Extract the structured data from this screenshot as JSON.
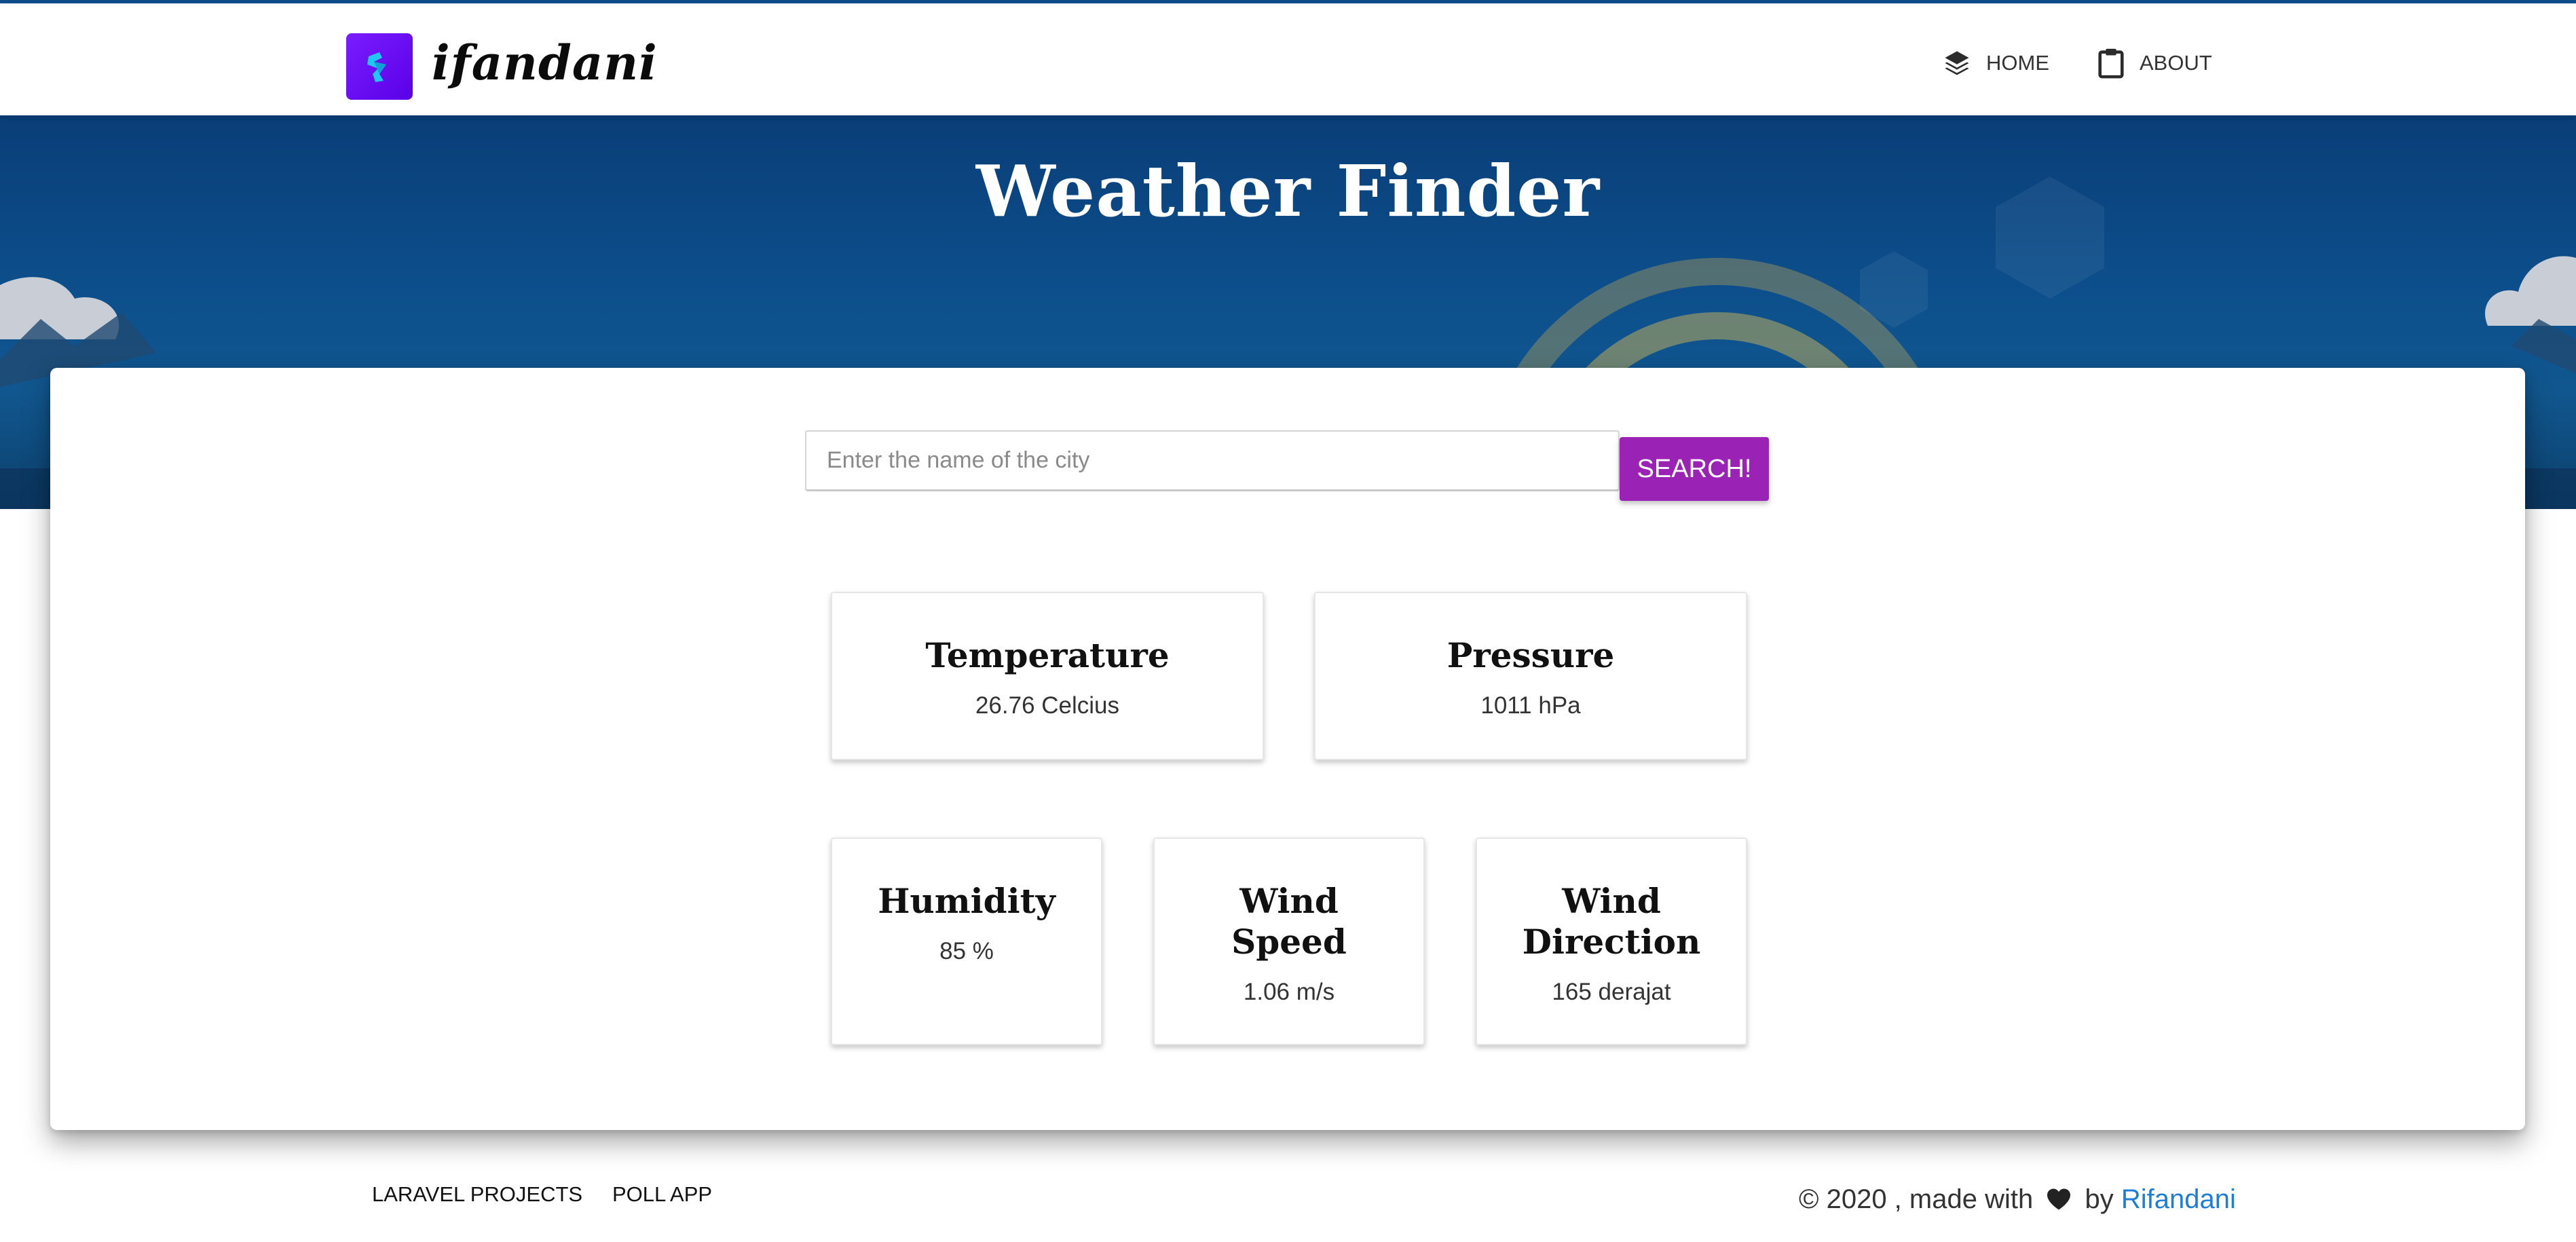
{
  "brand": {
    "name": "ifandani",
    "logo_glyph": "r",
    "logo_color": "#6b10ff"
  },
  "nav": {
    "home_label": "HOME",
    "about_label": "ABOUT"
  },
  "hero": {
    "title": "Weather Finder"
  },
  "search": {
    "value": "",
    "placeholder": "Enter the name of the city",
    "button_label": "SEARCH!",
    "button_color": "#9a23b5"
  },
  "stats": {
    "temperature": {
      "label": "Temperature",
      "value": "26.76 Celcius"
    },
    "pressure": {
      "label": "Pressure",
      "value": "1011 hPa"
    },
    "humidity": {
      "label": "Humidity",
      "value": "85 %"
    },
    "wind_speed": {
      "label_line1": "Wind",
      "label_line2": "Speed",
      "value": "1.06 m/s"
    },
    "wind_direction": {
      "label_line1": "Wind",
      "label_line2": "Direction",
      "value": "165 derajat"
    }
  },
  "footer": {
    "link1": "LARAVEL PROJECTS",
    "link2": "POLL APP",
    "credit_prefix": "© 2020 , made with",
    "credit_by": "by",
    "author": "Rifandani",
    "author_color": "#1e7ed6"
  }
}
